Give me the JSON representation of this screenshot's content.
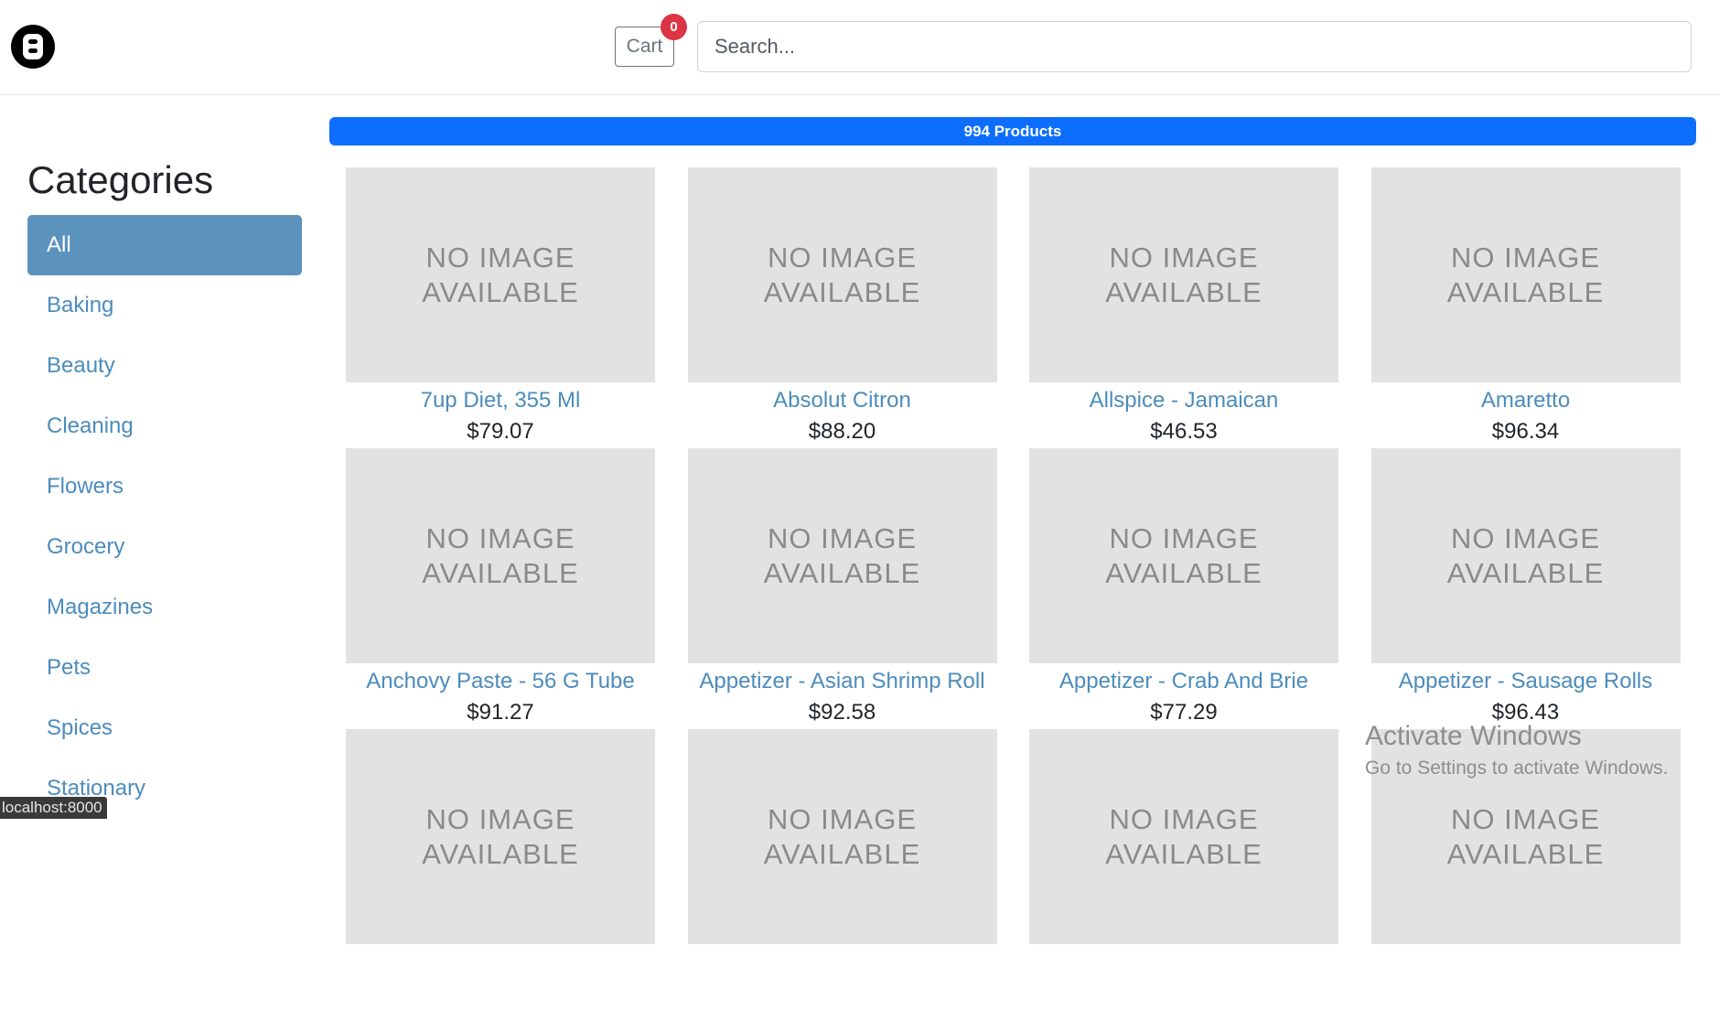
{
  "header": {
    "logo_name": "b-logo-icon",
    "cart_label": "Cart",
    "cart_count": "0",
    "search_placeholder": "Search...",
    "search_value": ""
  },
  "sidebar": {
    "title": "Categories",
    "active": "All",
    "items": [
      "All",
      "Baking",
      "Beauty",
      "Cleaning",
      "Flowers",
      "Grocery",
      "Magazines",
      "Pets",
      "Spices",
      "Stationary"
    ]
  },
  "main": {
    "product_count_label": "994 Products",
    "no_image_line1": "NO IMAGE",
    "no_image_line2": "AVAILABLE",
    "products": [
      {
        "name": "7up Diet, 355 Ml",
        "price": "$79.07"
      },
      {
        "name": "Absolut Citron",
        "price": "$88.20"
      },
      {
        "name": "Allspice - Jamaican",
        "price": "$46.53"
      },
      {
        "name": "Amaretto",
        "price": "$96.34"
      },
      {
        "name": "Anchovy Paste - 56 G Tube",
        "price": "$91.27"
      },
      {
        "name": "Appetizer - Asian Shrimp Roll",
        "price": "$92.58"
      },
      {
        "name": "Appetizer - Crab And Brie",
        "price": "$77.29"
      },
      {
        "name": "Appetizer - Sausage Rolls",
        "price": "$96.43"
      },
      {
        "name": "",
        "price": ""
      },
      {
        "name": "",
        "price": ""
      },
      {
        "name": "",
        "price": ""
      },
      {
        "name": "",
        "price": ""
      }
    ]
  },
  "system": {
    "status_url": "localhost:8000",
    "watermark_title": "Activate Windows",
    "watermark_subtitle": "Go to Settings to activate Windows."
  },
  "colors": {
    "accent": "#0d6efd",
    "link": "#4c8cbc",
    "active_category": "#5b93bd",
    "badge": "#dc3545",
    "placeholder_bg": "#e2e2e2"
  }
}
